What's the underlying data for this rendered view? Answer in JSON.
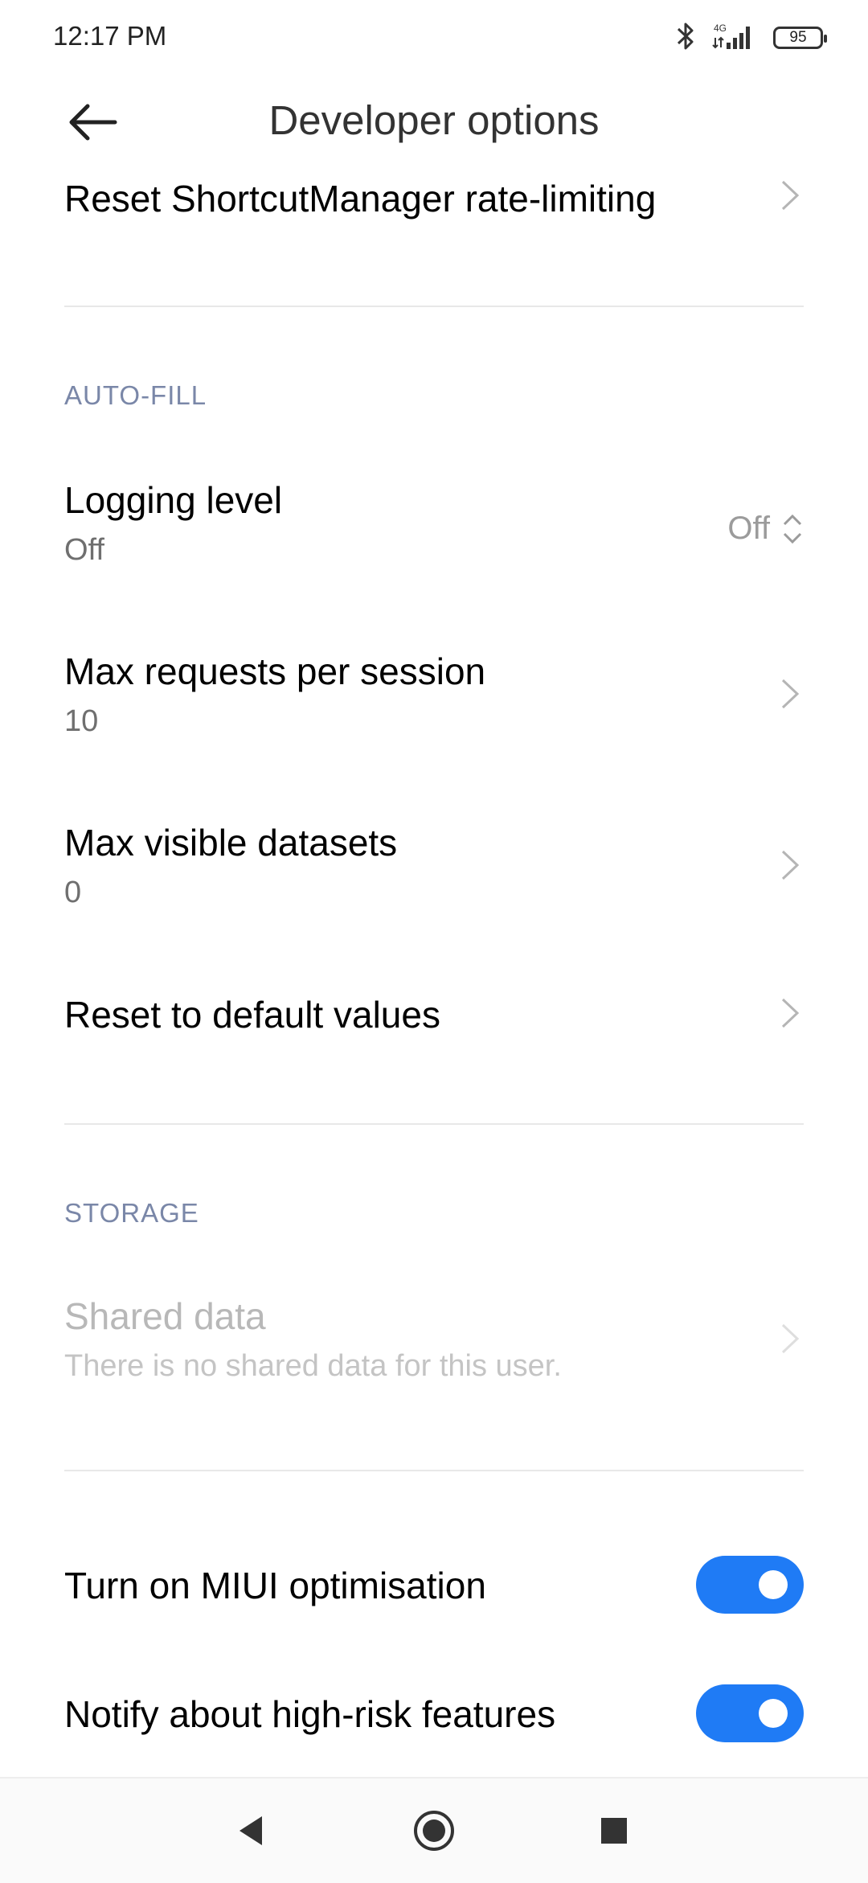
{
  "status_bar": {
    "time": "12:17 PM",
    "network": "4G",
    "battery": "95",
    "icons": [
      "bluetooth-icon",
      "signal-icon",
      "battery-icon"
    ]
  },
  "header": {
    "title": "Developer options",
    "back_icon": "back-arrow-icon"
  },
  "items": {
    "reset_shortcut": {
      "title": "Reset ShortcutManager rate-limiting"
    },
    "autofill_header": "AUTO-FILL",
    "logging_level": {
      "title": "Logging level",
      "subtitle": "Off",
      "value": "Off"
    },
    "max_requests": {
      "title": "Max requests per session",
      "subtitle": "10"
    },
    "max_visible": {
      "title": "Max visible datasets",
      "subtitle": "0"
    },
    "reset_defaults": {
      "title": "Reset to default values"
    },
    "storage_header": "STORAGE",
    "shared_data": {
      "title": "Shared data",
      "subtitle": "There is no shared data for this user."
    },
    "miui_opt": {
      "title": "Turn on MIUI optimisation",
      "enabled": true
    },
    "high_risk": {
      "title": "Notify about high-risk features",
      "enabled": true
    }
  },
  "colors": {
    "accent": "#1f7bf5",
    "section_header": "#7a87a8",
    "disabled_text": "#b8b8b8"
  },
  "nav": {
    "icons": [
      "nav-back-icon",
      "nav-home-icon",
      "nav-recents-icon"
    ]
  }
}
